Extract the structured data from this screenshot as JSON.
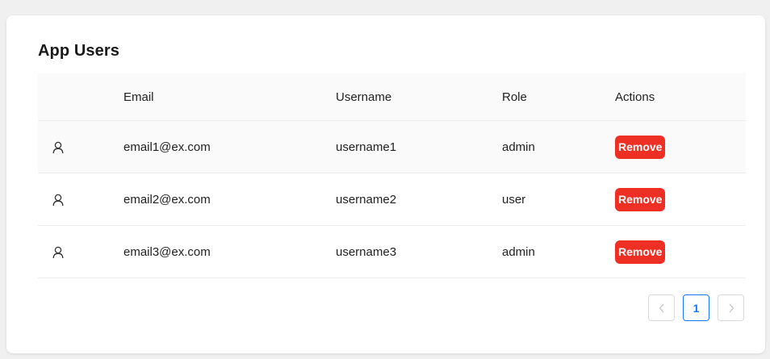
{
  "card": {
    "title": "App Users"
  },
  "table": {
    "columns": [
      "",
      "Email",
      "Username",
      "Role",
      "Actions"
    ],
    "rows": [
      {
        "icon": "user-icon",
        "email": "email1@ex.com",
        "username": "username1",
        "role": "admin",
        "action": "Remove"
      },
      {
        "icon": "user-icon",
        "email": "email2@ex.com",
        "username": "username2",
        "role": "user",
        "action": "Remove"
      },
      {
        "icon": "user-icon",
        "email": "email3@ex.com",
        "username": "username3",
        "role": "admin",
        "action": "Remove"
      }
    ]
  },
  "pagination": {
    "prev_icon": "chevron-left-icon",
    "current_page": "1",
    "next_icon": "chevron-right-icon"
  },
  "colors": {
    "remove_button": "#ee3024",
    "active_page": "#1677ff",
    "page_background": "#f0f0f0"
  }
}
